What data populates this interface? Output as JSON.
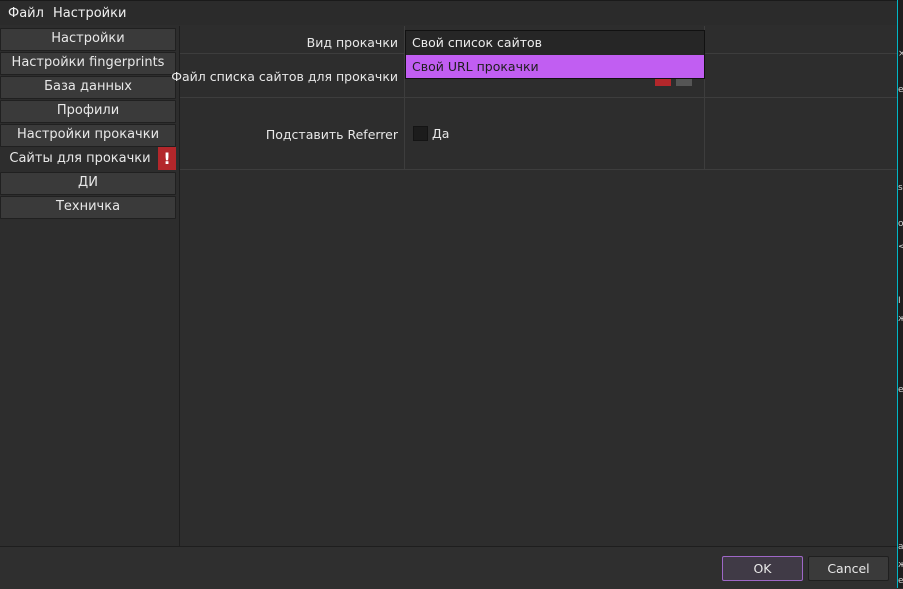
{
  "menubar": {
    "items": [
      "Файл",
      "Настройки"
    ]
  },
  "sidebar": {
    "items": [
      {
        "label": "Настройки"
      },
      {
        "label": "Настройки fingerprints"
      },
      {
        "label": "База данных"
      },
      {
        "label": "Профили"
      },
      {
        "label": "Настройки прокачки"
      },
      {
        "label": "Сайты для прокачки"
      },
      {
        "label": "ДИ"
      },
      {
        "label": "Техничка"
      }
    ],
    "warning_badge": "!"
  },
  "form": {
    "type_label": "Вид прокачки",
    "file_label": "Файл списка сайтов для прокачки",
    "referrer_label": "Подставить Referrer",
    "referrer_option": "Да",
    "dropdown_options": [
      "Свой список сайтов",
      "Свой URL прокачки"
    ]
  },
  "footer": {
    "ok_label": "OK",
    "cancel_label": "Cancel"
  }
}
